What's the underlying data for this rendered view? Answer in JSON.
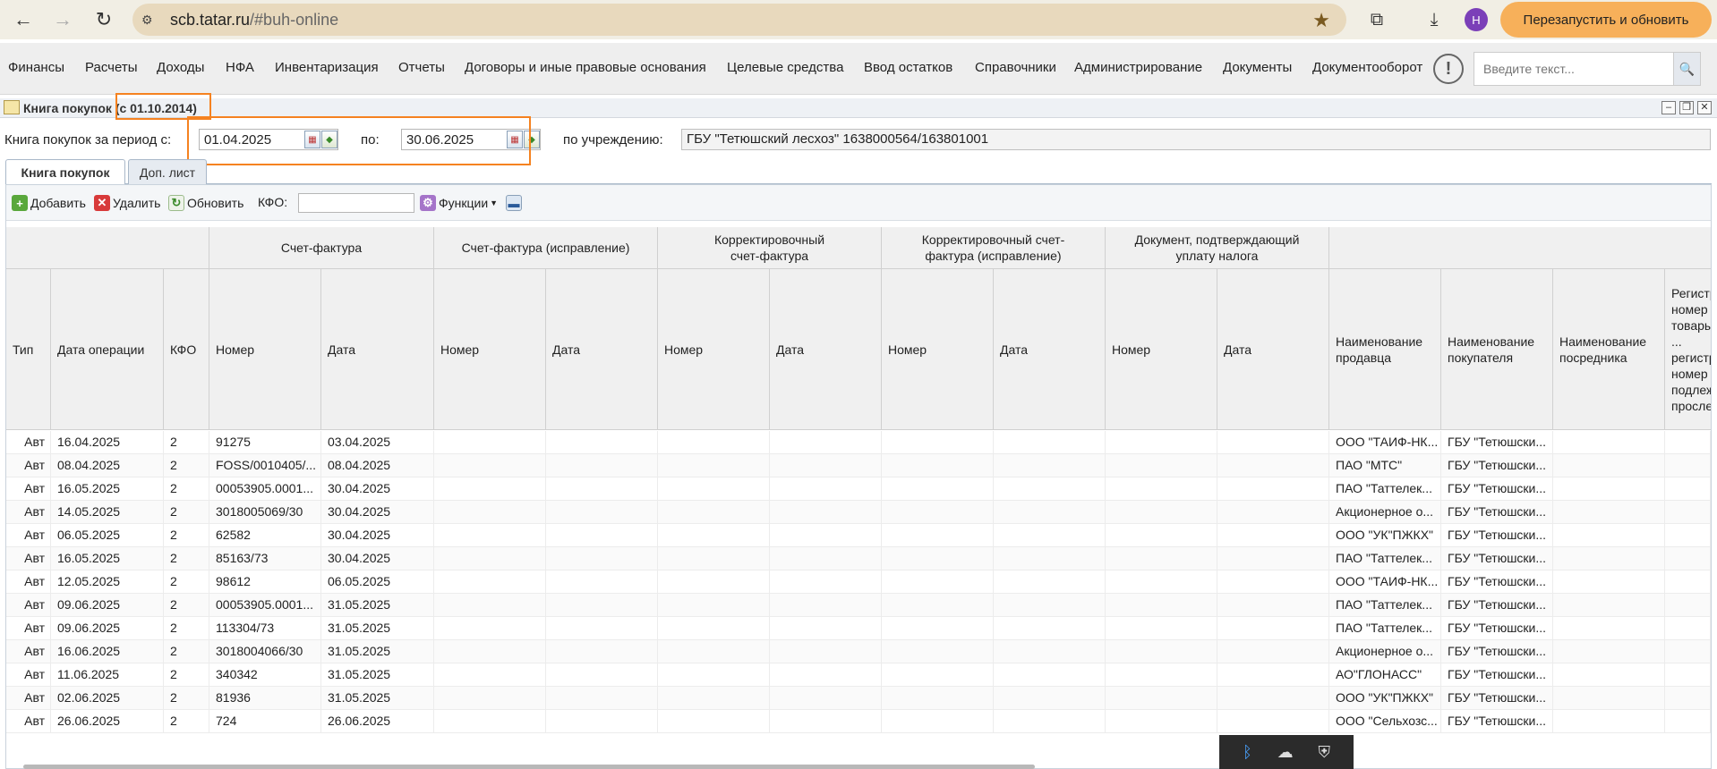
{
  "browser": {
    "url_host": "scb.tatar.ru",
    "url_path": "/#buh-online",
    "avatar_letter": "Н",
    "restart_label": "Перезапустить и обновить"
  },
  "menu": {
    "items": [
      "Финансы",
      "Расчеты",
      "Доходы",
      "НФА",
      "Инвентаризация",
      "Отчеты",
      "Договоры и иные правовые основания",
      "Целевые средства",
      "Ввод остатков",
      "Справочники",
      "Администрирование",
      "Документы",
      "Документооборот"
    ],
    "help_label": "!",
    "search_placeholder": "Введите текст..."
  },
  "window": {
    "title": "Книга покупок (с 01.10.2014)"
  },
  "period": {
    "label_from": "Книга покупок за период с:",
    "date_from": "01.04.2025",
    "label_to": "по:",
    "date_to": "30.06.2025",
    "label_org": "по учреждению:",
    "org": "ГБУ \"Тетюшский лесхоз\" 1638000564/163801001"
  },
  "tabs": [
    "Книга покупок",
    "Доп. лист"
  ],
  "toolbar": {
    "add": "Добавить",
    "delete": "Удалить",
    "refresh": "Обновить",
    "kfo_label": "КФО:",
    "functions": "Функции"
  },
  "grid": {
    "group_headers": [
      "Счет-фактура",
      "Счет-фактура (исправление)",
      "Корректировочный счет-фактура",
      "Корректировочный счет-фактура (исправление)",
      "Документ, подтверждающий уплату налога"
    ],
    "columns": [
      "Тип",
      "Дата операции",
      "КФО",
      "Номер",
      "Дата",
      "Номер",
      "Дата",
      "Номер",
      "Дата",
      "Номер",
      "Дата",
      "Номер",
      "Дата",
      "Наименование продавца",
      "Наименование покупателя",
      "Наименование посредника",
      "Регистр. номер ... товары ... регистр. номер подлеж. просле..."
    ],
    "rows": [
      {
        "type": "Авт",
        "op_date": "16.04.2025",
        "kfo": "2",
        "num": "91275",
        "date": "03.04.2025",
        "seller": "ООО \"ТАИФ-НК...",
        "buyer": "ГБУ \"Тетюшски..."
      },
      {
        "type": "Авт",
        "op_date": "08.04.2025",
        "kfo": "2",
        "num": "FOSS/0010405/...",
        "date": "08.04.2025",
        "seller": "ПАО \"МТС\"",
        "buyer": "ГБУ \"Тетюшски..."
      },
      {
        "type": "Авт",
        "op_date": "16.05.2025",
        "kfo": "2",
        "num": "00053905.0001...",
        "date": "30.04.2025",
        "seller": "ПАО \"Таттелек...",
        "buyer": "ГБУ \"Тетюшски..."
      },
      {
        "type": "Авт",
        "op_date": "14.05.2025",
        "kfo": "2",
        "num": "3018005069/30",
        "date": "30.04.2025",
        "seller": "Акционерное о...",
        "buyer": "ГБУ \"Тетюшски..."
      },
      {
        "type": "Авт",
        "op_date": "06.05.2025",
        "kfo": "2",
        "num": "62582",
        "date": "30.04.2025",
        "seller": "ООО \"УК\"ПЖКХ\"",
        "buyer": "ГБУ \"Тетюшски..."
      },
      {
        "type": "Авт",
        "op_date": "16.05.2025",
        "kfo": "2",
        "num": "85163/73",
        "date": "30.04.2025",
        "seller": "ПАО \"Таттелек...",
        "buyer": "ГБУ \"Тетюшски..."
      },
      {
        "type": "Авт",
        "op_date": "12.05.2025",
        "kfo": "2",
        "num": "98612",
        "date": "06.05.2025",
        "seller": "ООО \"ТАИФ-НК...",
        "buyer": "ГБУ \"Тетюшски..."
      },
      {
        "type": "Авт",
        "op_date": "09.06.2025",
        "kfo": "2",
        "num": "00053905.0001...",
        "date": "31.05.2025",
        "seller": "ПАО \"Таттелек...",
        "buyer": "ГБУ \"Тетюшски..."
      },
      {
        "type": "Авт",
        "op_date": "09.06.2025",
        "kfo": "2",
        "num": "113304/73",
        "date": "31.05.2025",
        "seller": "ПАО \"Таттелек...",
        "buyer": "ГБУ \"Тетюшски..."
      },
      {
        "type": "Авт",
        "op_date": "16.06.2025",
        "kfo": "2",
        "num": "3018004066/30",
        "date": "31.05.2025",
        "seller": "Акционерное о...",
        "buyer": "ГБУ \"Тетюшски..."
      },
      {
        "type": "Авт",
        "op_date": "11.06.2025",
        "kfo": "2",
        "num": "340342",
        "date": "31.05.2025",
        "seller": "АО\"ГЛОНАСС\"",
        "buyer": "ГБУ \"Тетюшски..."
      },
      {
        "type": "Авт",
        "op_date": "02.06.2025",
        "kfo": "2",
        "num": "81936",
        "date": "31.05.2025",
        "seller": "ООО \"УК\"ПЖКХ\"",
        "buyer": "ГБУ \"Тетюшски..."
      },
      {
        "type": "Авт",
        "op_date": "26.06.2025",
        "kfo": "2",
        "num": "724",
        "date": "26.06.2025",
        "seller": "ООО \"Сельхозс...",
        "buyer": "ГБУ \"Тетюшски..."
      }
    ]
  },
  "colors": {
    "highlight": "#f58220",
    "restart_button": "#f7b05a",
    "omnibox": "#e8d9bd"
  },
  "icons": [
    "back-icon",
    "forward-icon",
    "reload-icon",
    "site-info-icon",
    "bookmark-star-icon",
    "extensions-icon",
    "download-icon",
    "search-icon",
    "add-icon",
    "delete-icon",
    "refresh-icon",
    "functions-icon",
    "print-icon",
    "bluetooth-icon",
    "network-icon",
    "security-icon"
  ]
}
